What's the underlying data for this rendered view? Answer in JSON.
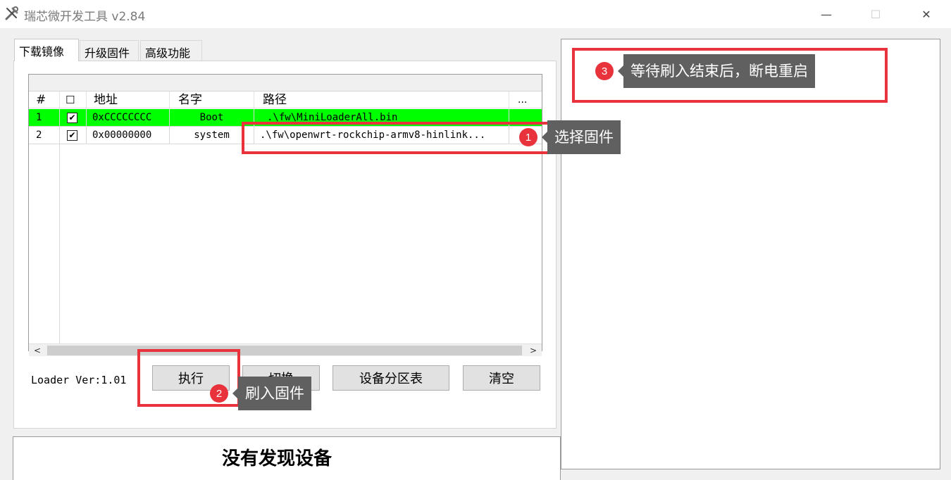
{
  "window": {
    "title": "瑞芯微开发工具 v2.84",
    "controls": {
      "minimize": "—",
      "maximize": "☐",
      "close": "✕"
    }
  },
  "tabs": [
    {
      "label": "下载镜像",
      "active": true
    },
    {
      "label": "升级固件",
      "active": false
    },
    {
      "label": "高级功能",
      "active": false
    }
  ],
  "table": {
    "headers": {
      "index": "#",
      "check": "☐",
      "address": "地址",
      "name": "名字",
      "path": "路径",
      "more": "..."
    },
    "rows": [
      {
        "index": "1",
        "checked": "✔",
        "address": "0xCCCCCCCC",
        "name": "Boot",
        "path": ".\\fw\\MiniLoaderAll.bin",
        "highlight": true
      },
      {
        "index": "2",
        "checked": "✔",
        "address": "0x00000000",
        "name": "system",
        "path": ".\\fw\\openwrt-rockchip-armv8-hinlink...",
        "highlight": false
      }
    ],
    "scroll_left": "<",
    "scroll_right": ">"
  },
  "loader_version": "Loader Ver:1.01",
  "buttons": {
    "execute": "执行",
    "switch": "切换",
    "partition_table": "设备分区表",
    "clear": "清空"
  },
  "status": "没有发现设备",
  "annotations": [
    {
      "number": "1",
      "text": "选择固件"
    },
    {
      "number": "2",
      "text": "刷入固件"
    },
    {
      "number": "3",
      "text": "等待刷入结束后，断电重启"
    }
  ],
  "colors": {
    "highlight_row": "#00ff00",
    "annotation_red": "#e8333c",
    "annotation_bubble": "#606060"
  }
}
